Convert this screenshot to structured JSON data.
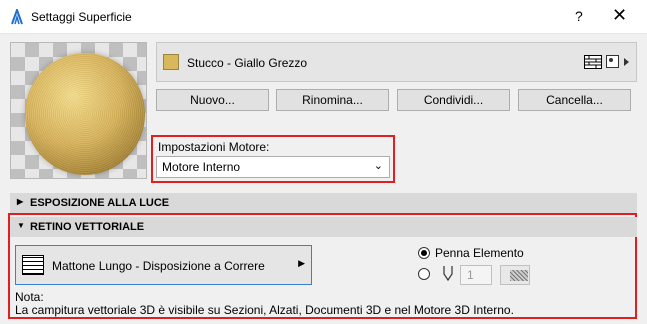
{
  "window": {
    "title": "Settaggi Superficie",
    "help_label": "?",
    "close_label": "✕"
  },
  "material": {
    "name": "Stucco - Giallo Grezzo",
    "swatch_color": "#d8b85a"
  },
  "buttons": {
    "new": "Nuovo...",
    "rename": "Rinomina...",
    "share": "Condividi...",
    "delete": "Cancella..."
  },
  "engine": {
    "label": "Impostazioni Motore:",
    "value": "Motore Interno"
  },
  "sections": {
    "exposure": "ESPOSIZIONE ALLA LUCE",
    "vector": "RETINO VETTORIALE"
  },
  "hatch": {
    "label": "Mattone Lungo - Disposizione a Correre"
  },
  "pen": {
    "element_label": "Penna Elemento",
    "pen_number": "1"
  },
  "note": {
    "label": "Nota:",
    "text": "La campitura vettoriale 3D è visibile su Sezioni, Alzati, Documenti 3D e nel Motore 3D Interno."
  },
  "accent_color": "#e02020"
}
